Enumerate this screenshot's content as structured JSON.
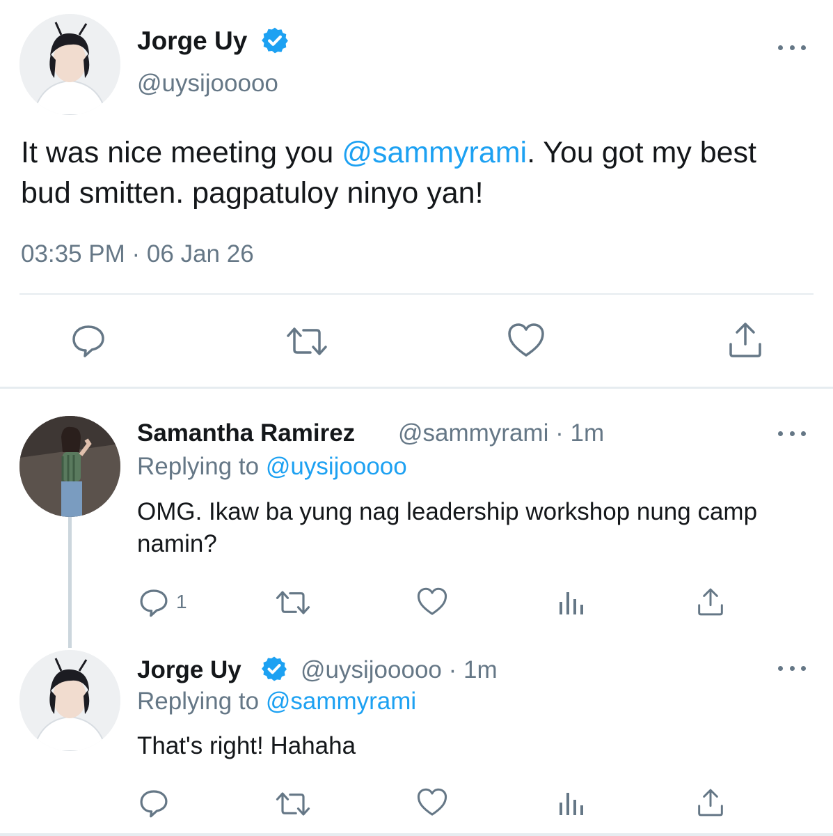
{
  "main_tweet": {
    "author_name": "Jorge Uy",
    "author_handle": "@uysijooooo",
    "text_before": "It was nice meeting you ",
    "mention": "@sammyrami",
    "text_after": ". You got my best bud smitten. pagpatuloy ninyo yan!",
    "timestamp": "03:35 PM · 06 Jan 26",
    "actions": [
      "reply-icon",
      "retweet-icon",
      "like-icon",
      "share-icon"
    ]
  },
  "replies": [
    {
      "author_name": "Samantha Ramirez",
      "author_handle": "@sammyrami",
      "time": "1m",
      "replying_label": "Replying to",
      "replying_to": "@uysijooooo",
      "text": "OMG. Ikaw ba yung nag leadership workshop nung camp namin?",
      "reply_count": "1",
      "verified": false
    },
    {
      "author_name": "Jorge Uy",
      "author_handle": "@uysijooooo",
      "time": "1m",
      "replying_label": "Replying to",
      "replying_to": "@sammyrami",
      "text": "That's right! Hahaha",
      "reply_count": "",
      "verified": true
    }
  ],
  "meta_separator": "·",
  "colors": {
    "accent": "#1da1f2",
    "secondary_text": "#657786",
    "primary_text": "#14171a",
    "divider": "#e6ecf0"
  }
}
